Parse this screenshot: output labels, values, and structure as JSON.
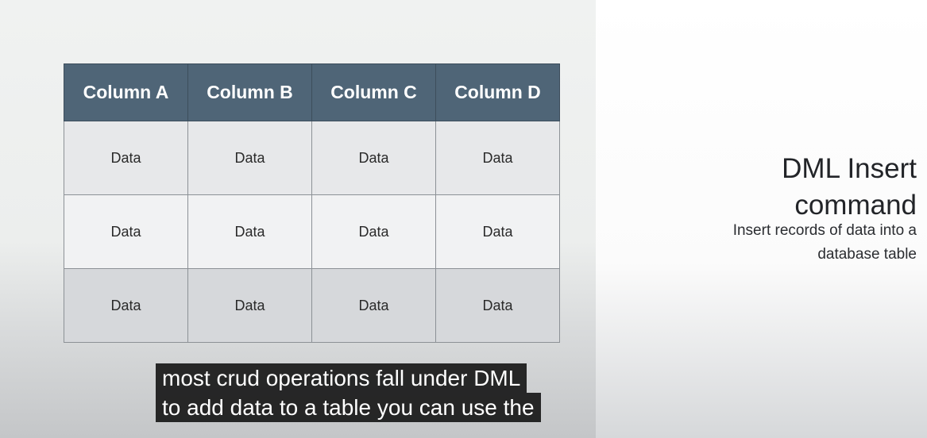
{
  "slide": {
    "table": {
      "columns": [
        "Column A",
        "Column B",
        "Column C",
        "Column D"
      ],
      "rows": [
        [
          "Data",
          "Data",
          "Data",
          "Data"
        ],
        [
          "Data",
          "Data",
          "Data",
          "Data"
        ],
        [
          "Data",
          "Data",
          "Data",
          "Data"
        ]
      ],
      "header_color": "#4f6577"
    },
    "title_line1": "DML Insert",
    "title_line2": "command",
    "subtitle_line1": "Insert records of data into a",
    "subtitle_line2": "database table"
  },
  "captions": {
    "line1": "most crud operations fall under DML",
    "line2": "to add data to a table you can use the"
  }
}
